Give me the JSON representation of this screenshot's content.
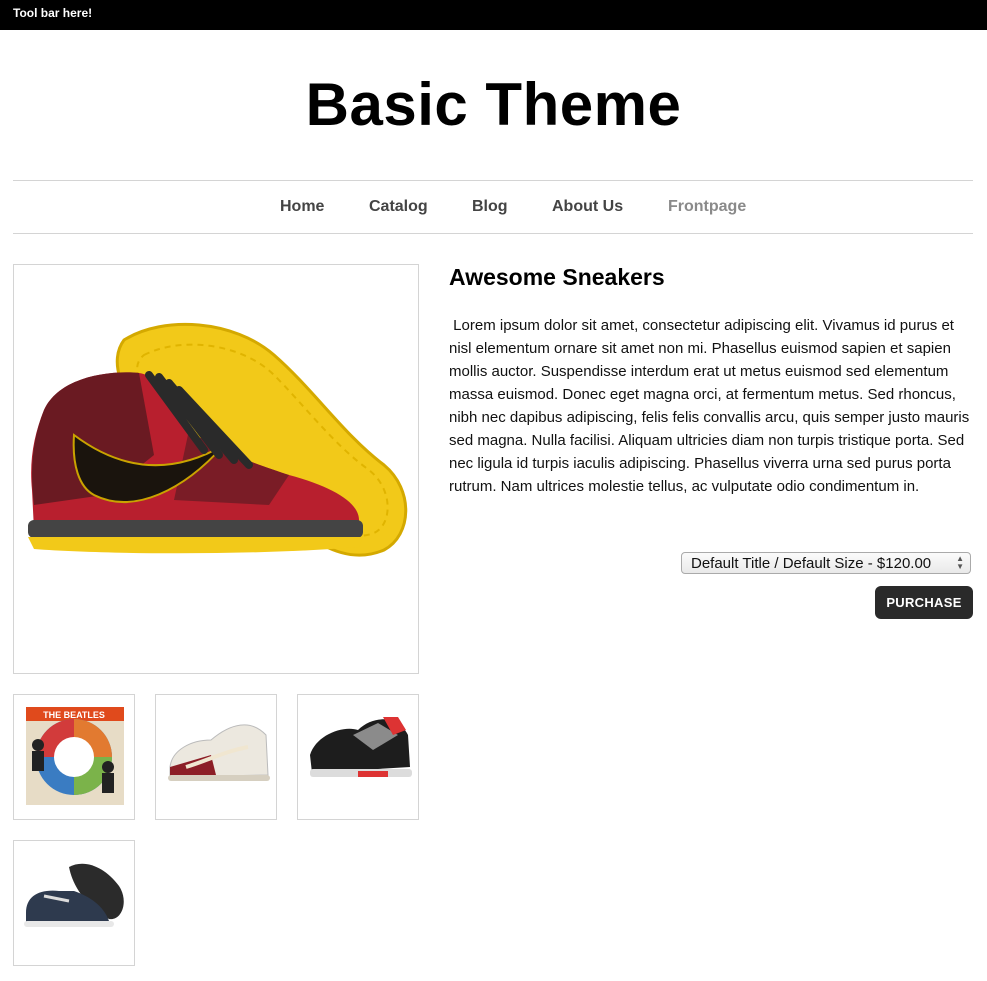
{
  "toolbar": {
    "text": "Tool bar here!"
  },
  "site": {
    "title": "Basic Theme"
  },
  "nav": {
    "items": [
      {
        "label": "Home"
      },
      {
        "label": "Catalog"
      },
      {
        "label": "Blog"
      },
      {
        "label": "About Us"
      },
      {
        "label": "Frontpage"
      }
    ],
    "active": "Frontpage"
  },
  "product": {
    "title": "Awesome Sneakers",
    "description": " Lorem ipsum dolor sit amet, consectetur adipiscing elit. Vivamus id purus et nisl elementum ornare sit amet non mi. Phasellus euismod sapien et sapien mollis auctor. Suspendisse interdum erat ut metus euismod sed elementum massa euismod. Donec eget magna orci, at fermentum metus. Sed rhoncus, nibh nec dapibus adipiscing, felis felis convallis arcu, quis semper justo mauris sed magna. Nulla facilisi. Aliquam ultricies diam non turpis tristique porta. Sed nec ligula id turpis iaculis adipiscing. Phasellus viverra urna sed purus porta rutrum. Nam ultrices molestie tellus, ac vulputate odio condimentum in.",
    "variant_selected": "Default Title / Default Size - $120.00",
    "purchase_label": "PURCHASE",
    "thumb_album_text": "THE BEATLES"
  },
  "colors": {
    "toolbar_bg": "#000000",
    "button_bg": "#2a2a2a",
    "nav_text": "#444444",
    "nav_active": "#8a8a8a"
  }
}
